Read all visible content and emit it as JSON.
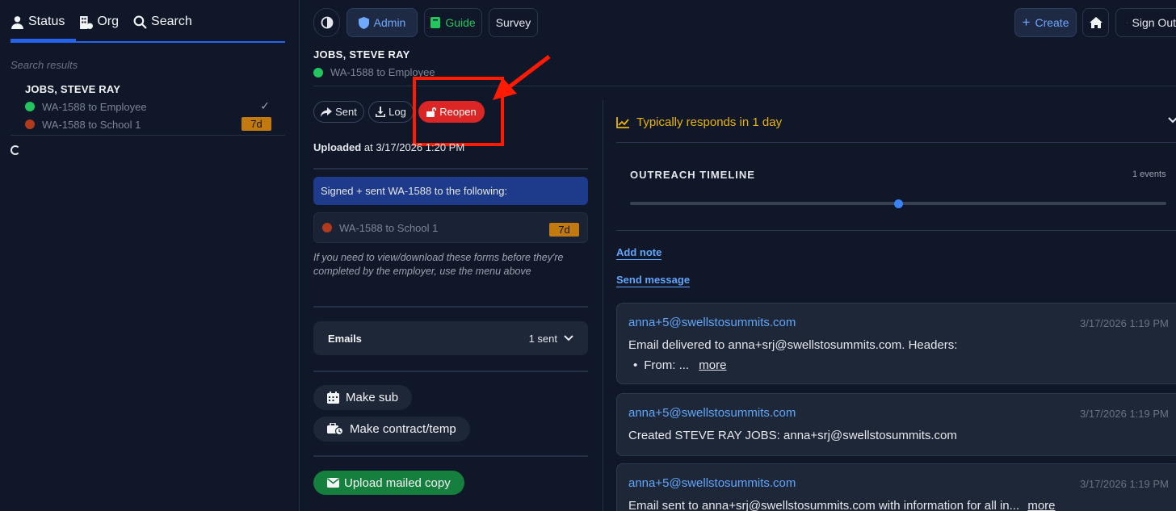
{
  "sidebar": {
    "nav": [
      {
        "label": "Status",
        "icon": "person-icon"
      },
      {
        "label": "Org",
        "icon": "building-icon"
      },
      {
        "label": "Search",
        "icon": "search-icon"
      }
    ],
    "search_results_label": "Search results",
    "result": {
      "name": "JOBS, STEVE RAY",
      "forms": [
        {
          "label": "WA-1588 to Employee",
          "status": "green",
          "check": "✓"
        },
        {
          "label": "WA-1588 to School 1",
          "status": "red",
          "badge": "7d"
        }
      ]
    }
  },
  "toolbar": {
    "theme_icon": "contrast-icon",
    "admin_label": "Admin",
    "guide_label": "Guide",
    "survey_label": "Survey",
    "create_label": "Create",
    "home_icon": "home-icon",
    "signout_label": "Sign Out"
  },
  "header": {
    "name": "JOBS, STEVE RAY",
    "subtitle": "WA-1588 to Employee"
  },
  "actions": {
    "sent_label": "Sent",
    "log_label": "Log",
    "reopen_label": "Reopen"
  },
  "upload": {
    "bold": "Uploaded",
    "rest": "at 3/17/2026 1:20 PM"
  },
  "signed": {
    "banner": "Signed + sent WA-1588 to the following:",
    "form_label": "WA-1588 to School 1",
    "form_badge": "7d"
  },
  "hint": "If you need to view/download these forms before they're completed by the employer, use the menu above",
  "emails": {
    "label": "Emails",
    "count": "1 sent"
  },
  "buttons": {
    "make_sub": "Make sub",
    "make_contract": "Make contract/temp",
    "upload_mailed": "Upload mailed copy"
  },
  "right": {
    "responds": "Typically responds in 1 day",
    "timeline_title": "OUTREACH TIMELINE",
    "timeline_count": "1 events",
    "timeline_position": 0.5,
    "add_note": "Add note",
    "send_message": "Send message",
    "messages": [
      {
        "from": "anna+5@swellstosummits.com",
        "date": "3/17/2026 1:19 PM",
        "body": "Email delivered to anna+srj@swellstosummits.com. Headers:",
        "bullet": "From:   ...",
        "more": "more"
      },
      {
        "from": "anna+5@swellstosummits.com",
        "date": "3/17/2026 1:19 PM",
        "body": "Created STEVE RAY JOBS: anna+srj@swellstosummits.com"
      },
      {
        "from": "anna+5@swellstosummits.com",
        "date": "3/17/2026 1:19 PM",
        "body": "Email sent to anna+srj@swellstosummits.com with information for all in...",
        "more": "more"
      }
    ]
  },
  "colors": {
    "background": "#0f1729",
    "accent": "#2563eb",
    "danger": "#dc2626",
    "success": "#15803d",
    "warning": "#eab308"
  }
}
